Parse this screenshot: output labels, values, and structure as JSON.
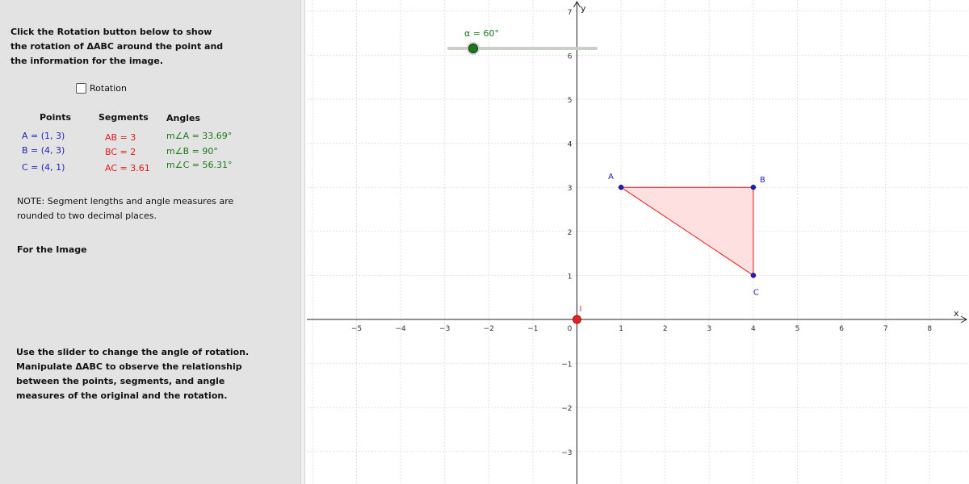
{
  "instructions": {
    "line1": "Click the Rotation button below to show",
    "line2": "the rotation of ΔABC around the point and",
    "line3": "the information for the image."
  },
  "rotation_toggle": {
    "label": "Rotation",
    "checked": false
  },
  "table": {
    "headers": {
      "points": "Points",
      "segments": "Segments",
      "angles": "Angles"
    },
    "points": [
      "A = (1, 3)",
      "B = (4, 3)",
      "C = (4, 1)"
    ],
    "segments": [
      "AB = 3",
      "BC = 2",
      "AC = 3.61"
    ],
    "angles": [
      "m∠A = 33.69°",
      "m∠B = 90°",
      "m∠C = 56.31°"
    ]
  },
  "note": {
    "line1": "NOTE: Segment lengths and angle measures are",
    "line2": "rounded to two decimal places."
  },
  "image_heading": "For the Image",
  "usage": {
    "line1": "Use the slider to change the angle of rotation.",
    "line2": "Manipulate ΔABC to observe the relationship",
    "line3": "between the points, segments, and angle",
    "line4": "measures of the original and the rotation."
  },
  "slider": {
    "label": "α = 60°",
    "value": 60,
    "min": 0,
    "max": 360
  },
  "graph": {
    "x_axis_label": "x",
    "y_axis_label": "y",
    "x_ticks": [
      -5,
      -4,
      -3,
      -2,
      -1,
      0,
      1,
      2,
      3,
      4,
      5,
      6,
      7,
      8
    ],
    "y_ticks": [
      -3,
      -2,
      -1,
      1,
      2,
      3,
      4,
      5,
      6,
      7
    ],
    "center_label": "I",
    "center": [
      0,
      0
    ],
    "vertices": [
      {
        "name": "A",
        "x": 1,
        "y": 3
      },
      {
        "name": "B",
        "x": 4,
        "y": 3
      },
      {
        "name": "C",
        "x": 4,
        "y": 1
      }
    ]
  },
  "colors": {
    "panel_bg": "#e3e3e3",
    "point_blue": "#1f1fb8",
    "segment_red": "#e01818",
    "angle_green": "#1a7a1a",
    "triangle_fill": "#ffdddd",
    "center_red": "#e82020"
  }
}
